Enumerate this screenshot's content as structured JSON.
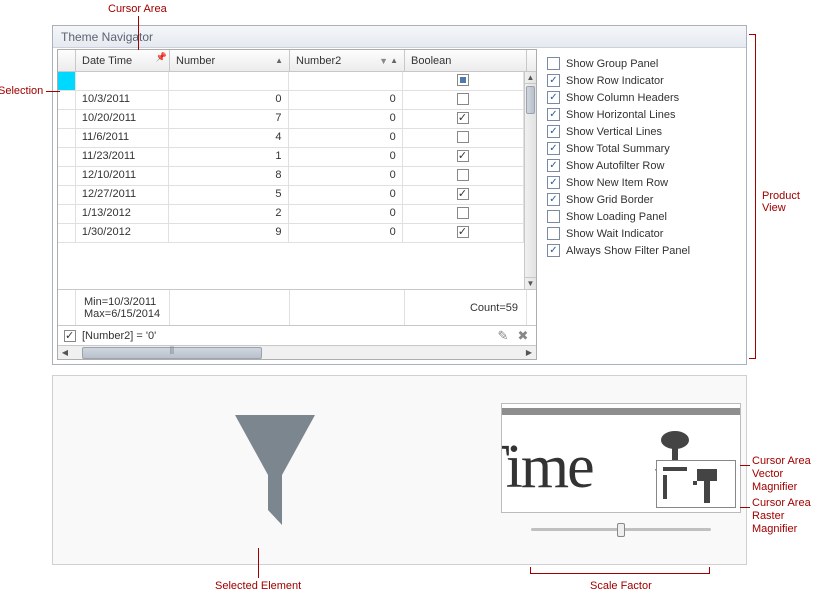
{
  "panel": {
    "title": "Theme Navigator"
  },
  "grid": {
    "columns": {
      "datetime": "Date Time",
      "number": "Number",
      "number2": "Number2",
      "boolean": "Boolean"
    },
    "rows": [
      {
        "dt": "10/3/2011",
        "num": "0",
        "num2": "0",
        "bool": false
      },
      {
        "dt": "10/20/2011",
        "num": "7",
        "num2": "0",
        "bool": true
      },
      {
        "dt": "11/6/2011",
        "num": "4",
        "num2": "0",
        "bool": false
      },
      {
        "dt": "11/23/2011",
        "num": "1",
        "num2": "0",
        "bool": true
      },
      {
        "dt": "12/10/2011",
        "num": "8",
        "num2": "0",
        "bool": false
      },
      {
        "dt": "12/27/2011",
        "num": "5",
        "num2": "0",
        "bool": true
      },
      {
        "dt": "1/13/2012",
        "num": "2",
        "num2": "0",
        "bool": false
      },
      {
        "dt": "1/30/2012",
        "num": "9",
        "num2": "0",
        "bool": true
      }
    ],
    "summary": {
      "min": "Min=10/3/2011",
      "max": "Max=6/15/2014",
      "count": "Count=59"
    },
    "filter_expr": "[Number2] = '0'"
  },
  "options": [
    {
      "label": "Show Group Panel",
      "checked": false
    },
    {
      "label": "Show Row Indicator",
      "checked": true
    },
    {
      "label": "Show Column Headers",
      "checked": true
    },
    {
      "label": "Show Horizontal Lines",
      "checked": true
    },
    {
      "label": "Show Vertical Lines",
      "checked": true
    },
    {
      "label": "Show Total Summary",
      "checked": true
    },
    {
      "label": "Show Autofilter Row",
      "checked": true
    },
    {
      "label": "Show New Item Row",
      "checked": true
    },
    {
      "label": "Show Grid Border",
      "checked": true
    },
    {
      "label": "Show Loading Panel",
      "checked": false
    },
    {
      "label": "Show Wait Indicator",
      "checked": false
    },
    {
      "label": "Always Show Filter Panel",
      "checked": true
    }
  ],
  "magnifier": {
    "text": "Time"
  },
  "annotations": {
    "cursor_area": "Cursor Area",
    "selection": "Selection",
    "product_view": "Product View",
    "selected_element": "Selected Element",
    "scale_factor": "Scale Factor",
    "vector_mag_l1": "Cursor Area",
    "vector_mag_l2": "Vector Magnifier",
    "raster_mag_l1": "Cursor Area",
    "raster_mag_l2": "Raster Magnifier"
  }
}
